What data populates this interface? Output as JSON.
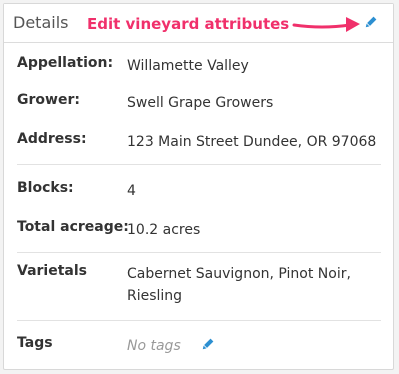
{
  "card": {
    "title": "Details",
    "annotation": "Edit vineyard attributes",
    "annotation_color": "#f0306b",
    "edit_icon": "pencil-icon",
    "accent_color": "#2c8fd1"
  },
  "fields": {
    "appellation": {
      "label": "Appellation:",
      "value": "Willamette Valley"
    },
    "grower": {
      "label": "Grower:",
      "value": "Swell Grape Growers"
    },
    "address": {
      "label": "Address:",
      "value": "123 Main Street Dundee, OR 97068"
    },
    "blocks": {
      "label": "Blocks:",
      "value": "4"
    },
    "acreage": {
      "label": "Total acreage:",
      "value": "10.2 acres"
    },
    "varietals": {
      "label": "Varietals",
      "value": "Cabernet Sauvignon, Pinot Noir, Riesling"
    },
    "tags": {
      "label": "Tags",
      "value": "No tags"
    }
  }
}
